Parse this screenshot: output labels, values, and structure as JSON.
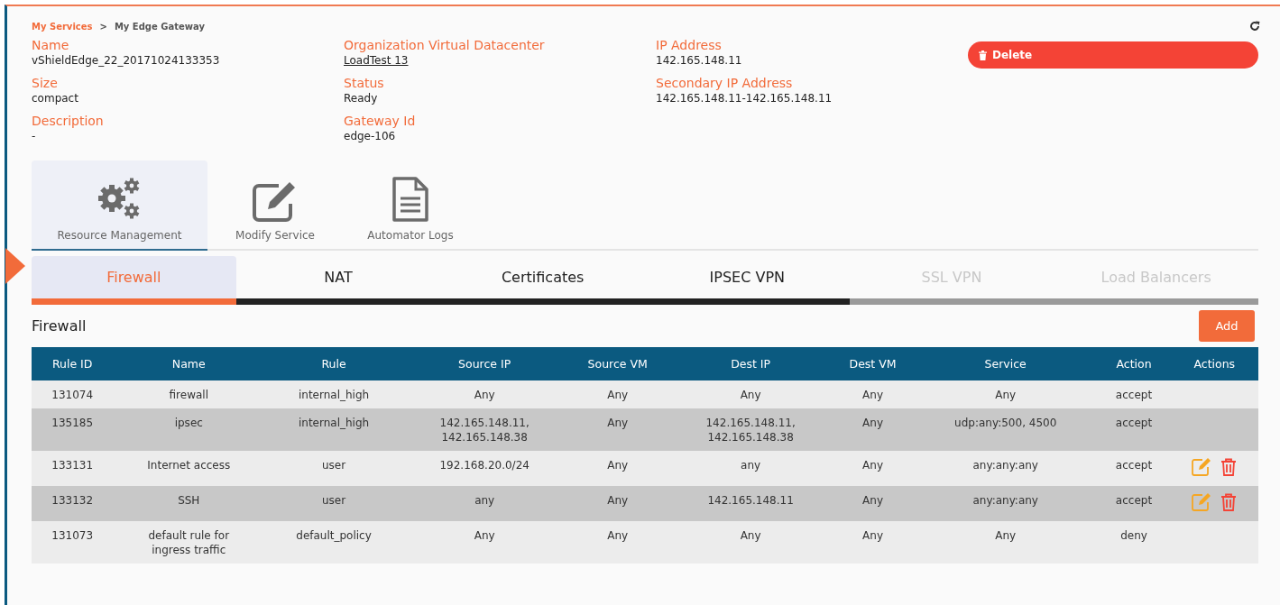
{
  "breadcrumb": [
    {
      "label": "My Services",
      "link": true
    },
    {
      "label": ">",
      "link": false
    },
    {
      "label": "My Edge Gateway",
      "link": false
    }
  ],
  "details": [
    {
      "label": "Name",
      "value": "vShieldEdge_22_20171024133353",
      "link": false
    },
    {
      "label": "Size",
      "value": "compact",
      "link": false
    },
    {
      "label": "Description",
      "value": "-",
      "link": false
    },
    {
      "label": "Organization Virtual Datacenter",
      "value": "LoadTest 13",
      "link": true
    },
    {
      "label": "Status",
      "value": "Ready",
      "link": false
    },
    {
      "label": "Gateway Id",
      "value": "edge-106",
      "link": false
    },
    {
      "label": "IP Address",
      "value": "142.165.148.11",
      "link": false
    },
    {
      "label": "Secondary IP Address",
      "value": "142.165.148.11-142.165.148.11",
      "link": false
    }
  ],
  "delete_button": "Delete",
  "service_tabs": [
    {
      "label": "Resource Management",
      "kind": "gears",
      "selected": true
    },
    {
      "label": "Modify Service",
      "kind": "edit",
      "selected": false
    },
    {
      "label": "Automator Logs",
      "kind": "document",
      "selected": false
    }
  ],
  "tabs": [
    {
      "label": "Firewall",
      "selected": true,
      "disabled": false
    },
    {
      "label": "NAT",
      "selected": false,
      "disabled": false
    },
    {
      "label": "Certificates",
      "selected": false,
      "disabled": false
    },
    {
      "label": "IPSEC VPN",
      "selected": false,
      "disabled": false
    },
    {
      "label": "SSL VPN",
      "selected": false,
      "disabled": true
    },
    {
      "label": "Load Balancers",
      "selected": false,
      "disabled": true
    }
  ],
  "section_title": "Firewall",
  "add_button": "Add",
  "table": {
    "columns": [
      "Rule ID",
      "Name",
      "Rule",
      "Source IP",
      "Source VM",
      "Dest IP",
      "Dest VM",
      "Service",
      "Action",
      "Actions"
    ],
    "rows": [
      {
        "cells": [
          "131074",
          "firewall",
          "internal_high",
          "Any",
          "Any",
          "Any",
          "Any",
          "Any",
          "accept"
        ],
        "editable": false
      },
      {
        "cells": [
          "135185",
          "ipsec",
          "internal_high",
          "142.165.148.11,\n142.165.148.38",
          "Any",
          "142.165.148.11,\n142.165.148.38",
          "Any",
          "udp:any:500, 4500",
          "accept"
        ],
        "editable": false
      },
      {
        "cells": [
          "133131",
          "Internet access",
          "user",
          "192.168.20.0/24",
          "Any",
          "any",
          "Any",
          "any:any:any",
          "accept"
        ],
        "editable": true
      },
      {
        "cells": [
          "133132",
          "SSH",
          "user",
          "any",
          "Any",
          "142.165.148.11",
          "Any",
          "any:any:any",
          "accept"
        ],
        "editable": true
      },
      {
        "cells": [
          "131073",
          "default rule for\ningress traffic",
          "default_policy",
          "Any",
          "Any",
          "Any",
          "Any",
          "Any",
          "deny"
        ],
        "editable": false
      }
    ]
  }
}
